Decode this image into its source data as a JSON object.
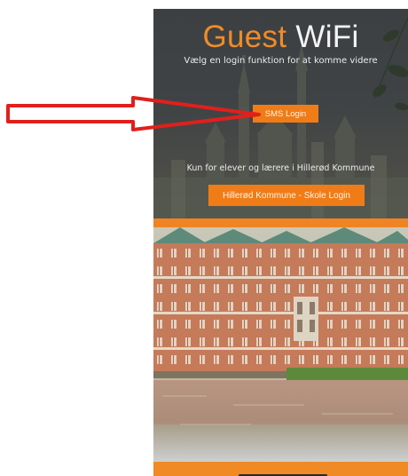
{
  "header": {
    "title_primary": "Guest",
    "title_secondary": "WiFi",
    "subtitle": "Vælg en login funktion for at komme videre"
  },
  "sms_login": {
    "label": "SMS Login"
  },
  "school_section": {
    "note": "Kun for elever og lærere i Hillerød Kommune",
    "button_label": "Hillerød Kommune - Skole Login"
  },
  "colors": {
    "accent": "#f07c18",
    "background_dark": "#3d4043",
    "annotation_arrow": "#e0201c"
  },
  "icons": {
    "annotation": "arrow-right-icon"
  }
}
